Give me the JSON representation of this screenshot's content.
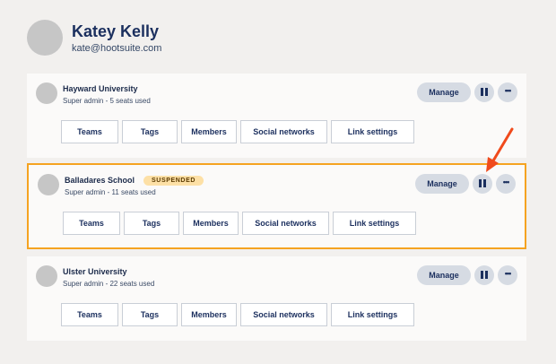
{
  "profile": {
    "name": "Katey Kelly",
    "email": "kate@hootsuite.com"
  },
  "orgs": [
    {
      "name": "Hayward University",
      "subtitle": "Super admin - 5 seats used",
      "badge": ""
    },
    {
      "name": "Balladares School",
      "subtitle": "Super admin - 11 seats used",
      "badge": "SUSPENDED"
    },
    {
      "name": "Ulster University",
      "subtitle": "Super admin - 22 seats used",
      "badge": ""
    }
  ],
  "buttons": {
    "manage": "Manage",
    "more": "•••"
  },
  "tabs": [
    "Teams",
    "Tags",
    "Members",
    "Social networks",
    "Link settings"
  ],
  "colors": {
    "highlight_border": "#f5a321",
    "badge_bg": "#fde0a6",
    "arrow": "#f04a1c"
  },
  "icons": {
    "pause": "pause-icon",
    "more": "more-icon",
    "annotation": "red-arrow"
  }
}
